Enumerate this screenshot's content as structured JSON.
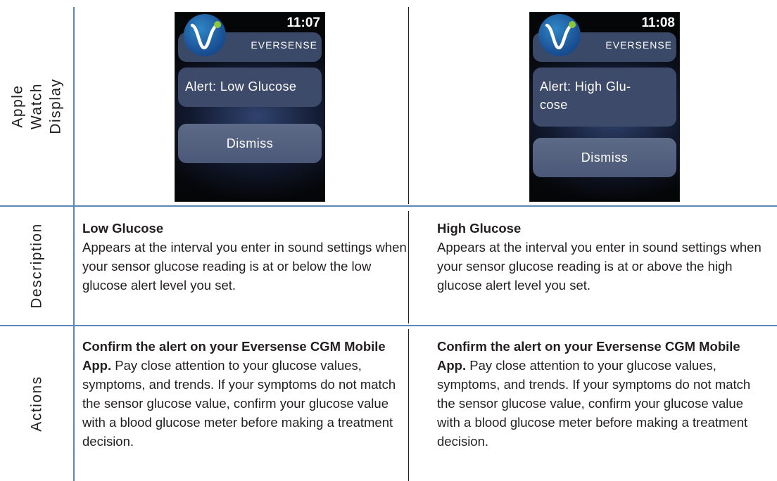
{
  "rows": {
    "display_header": "Apple Watch Display",
    "description_header": "Description",
    "actions_header": "Actions"
  },
  "watch_low": {
    "time": "11:07",
    "brand": "EVERSENSE",
    "alert": "Alert:  Low Glucose",
    "dismiss": "Dismiss"
  },
  "watch_high": {
    "time": "11:08",
    "brand": "EVERSENSE",
    "alert_line1": "Alert:  High Glu-",
    "alert_line2": "cose",
    "dismiss": "Dismiss"
  },
  "descriptions": {
    "low_title": "Low Glucose",
    "low_body": "Appears at the interval you enter in sound settings when your sensor glucose reading is at or below the low glucose alert level you set.",
    "high_title": "High Glucose",
    "high_body": "Appears at the interval you enter in sound settings when your sensor glucose reading is at or above the high glucose alert level you set."
  },
  "actions": {
    "low_bold": "Confirm the alert on your Eversense CGM Mobile App.",
    "low_body": " Pay close attention to your glucose values, symptoms, and trends. If your symptoms do not match the sensor glucose value, confirm your glucose value with a blood glucose meter before making a treatment decision.",
    "high_bold": "Confirm the alert on your Eversense CGM Mobile App.",
    "high_body": " Pay close attention to your glucose values, symptoms, and trends. If your symptoms do not match the sensor glucose value, confirm your glucose value with a blood glucose meter before making a treatment decision."
  },
  "colors": {
    "rule": "#5a86b9",
    "text": "#231f20",
    "logo": "#1a4f93",
    "logo_accent": "#8cc63f"
  }
}
